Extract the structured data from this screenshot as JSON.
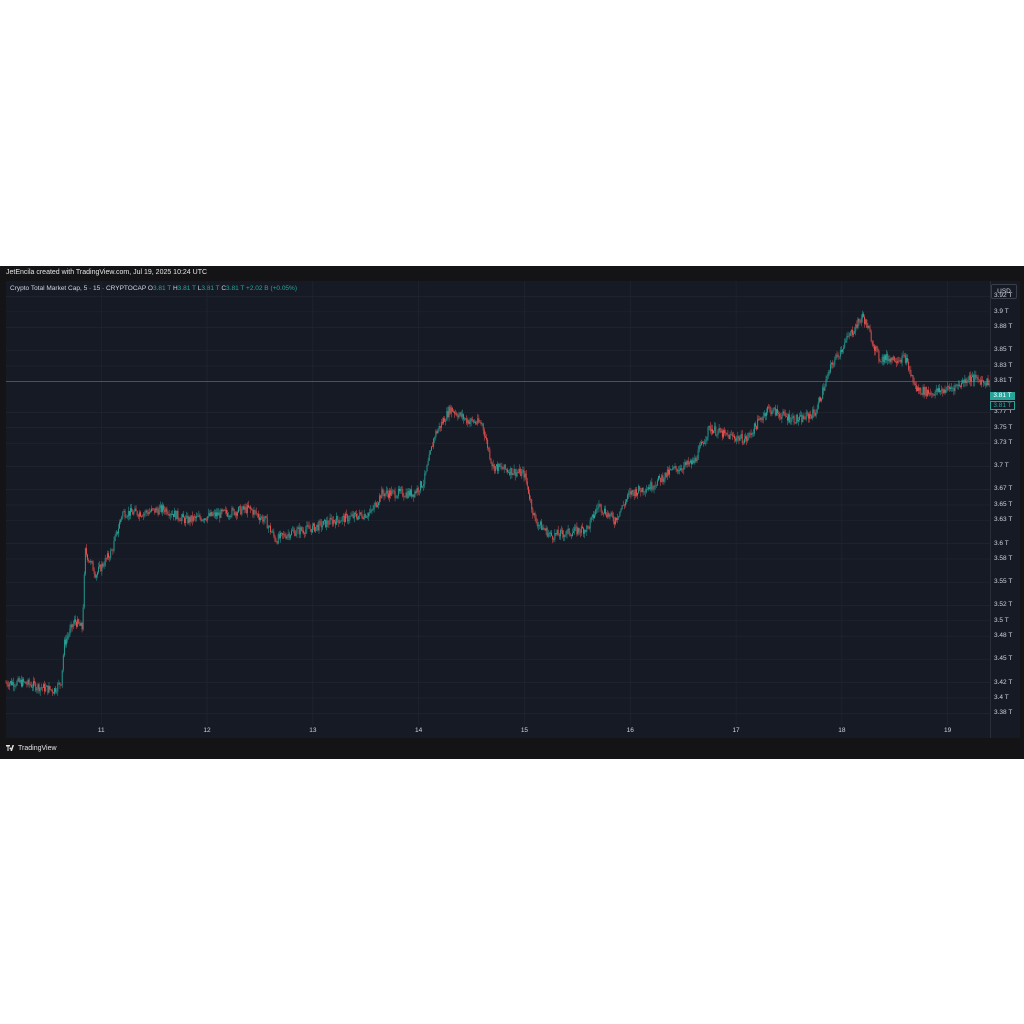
{
  "attribution": "JetEncila created with TradingView.com, Jul 19, 2025 10:24 UTC",
  "legend": {
    "symbol": "Crypto Total Market Cap, 5 · 15 · CRYPTOCAP",
    "o_label": "O",
    "o_value": "3.81 T",
    "h_label": "H",
    "h_value": "3.81 T",
    "l_label": "L",
    "l_value": "3.81 T",
    "c_label": "C",
    "c_value": "3.81 T",
    "change": "+2.02 B (+0.05%)"
  },
  "currency_button": "USD",
  "last_price_labels": [
    "3.81 T",
    "3.81 T"
  ],
  "footer_logo": "TradingView",
  "colors": {
    "up": "#26a69a",
    "down": "#ef5350",
    "background": "#161a25",
    "grid": "#232733"
  },
  "chart_data": {
    "type": "candlestick",
    "y_unit": "T",
    "ylim": [
      3.365,
      3.94
    ],
    "yticks": [
      "3.92 T",
      "3.9 T",
      "3.88 T",
      "3.85 T",
      "3.83 T",
      "3.81 T",
      "3.77 T",
      "3.75 T",
      "3.73 T",
      "3.7 T",
      "3.67 T",
      "3.65 T",
      "3.63 T",
      "3.6 T",
      "3.58 T",
      "3.55 T",
      "3.52 T",
      "3.5 T",
      "3.48 T",
      "3.45 T",
      "3.42 T",
      "3.4 T",
      "3.38 T"
    ],
    "ytick_values": [
      3.92,
      3.9,
      3.88,
      3.85,
      3.83,
      3.81,
      3.77,
      3.75,
      3.73,
      3.7,
      3.67,
      3.65,
      3.63,
      3.6,
      3.58,
      3.55,
      3.52,
      3.5,
      3.48,
      3.45,
      3.42,
      3.4,
      3.38
    ],
    "xticks": [
      "11",
      "12",
      "13",
      "14",
      "15",
      "16",
      "17",
      "18",
      "19"
    ],
    "xtick_days": [
      11,
      12,
      13,
      14,
      15,
      16,
      17,
      18,
      19
    ],
    "xlim_days": [
      10.1,
      19.4
    ],
    "grid": true,
    "last_price": 3.81,
    "series_path": [
      [
        10.1,
        3.42
      ],
      [
        10.25,
        3.42
      ],
      [
        10.4,
        3.415
      ],
      [
        10.55,
        3.41
      ],
      [
        10.62,
        3.42
      ],
      [
        10.65,
        3.47
      ],
      [
        10.75,
        3.5
      ],
      [
        10.82,
        3.49
      ],
      [
        10.85,
        3.59
      ],
      [
        10.95,
        3.56
      ],
      [
        11.1,
        3.59
      ],
      [
        11.2,
        3.64
      ],
      [
        11.4,
        3.64
      ],
      [
        11.6,
        3.645
      ],
      [
        11.8,
        3.63
      ],
      [
        12.0,
        3.635
      ],
      [
        12.2,
        3.64
      ],
      [
        12.4,
        3.645
      ],
      [
        12.55,
        3.63
      ],
      [
        12.65,
        3.605
      ],
      [
        12.8,
        3.615
      ],
      [
        13.0,
        3.62
      ],
      [
        13.2,
        3.63
      ],
      [
        13.4,
        3.635
      ],
      [
        13.55,
        3.64
      ],
      [
        13.65,
        3.665
      ],
      [
        13.8,
        3.665
      ],
      [
        13.95,
        3.665
      ],
      [
        14.05,
        3.68
      ],
      [
        14.15,
        3.74
      ],
      [
        14.3,
        3.775
      ],
      [
        14.45,
        3.76
      ],
      [
        14.6,
        3.755
      ],
      [
        14.7,
        3.7
      ],
      [
        14.85,
        3.695
      ],
      [
        15.0,
        3.69
      ],
      [
        15.1,
        3.63
      ],
      [
        15.25,
        3.61
      ],
      [
        15.45,
        3.615
      ],
      [
        15.6,
        3.62
      ],
      [
        15.7,
        3.65
      ],
      [
        15.85,
        3.63
      ],
      [
        16.0,
        3.665
      ],
      [
        16.2,
        3.675
      ],
      [
        16.4,
        3.695
      ],
      [
        16.6,
        3.705
      ],
      [
        16.75,
        3.75
      ],
      [
        16.9,
        3.74
      ],
      [
        17.1,
        3.735
      ],
      [
        17.3,
        3.775
      ],
      [
        17.45,
        3.765
      ],
      [
        17.6,
        3.76
      ],
      [
        17.75,
        3.77
      ],
      [
        17.9,
        3.83
      ],
      [
        18.05,
        3.865
      ],
      [
        18.2,
        3.895
      ],
      [
        18.35,
        3.84
      ],
      [
        18.5,
        3.84
      ],
      [
        18.6,
        3.84
      ],
      [
        18.7,
        3.8
      ],
      [
        18.85,
        3.795
      ],
      [
        19.0,
        3.8
      ],
      [
        19.1,
        3.805
      ],
      [
        19.2,
        3.815
      ],
      [
        19.35,
        3.81
      ]
    ]
  }
}
